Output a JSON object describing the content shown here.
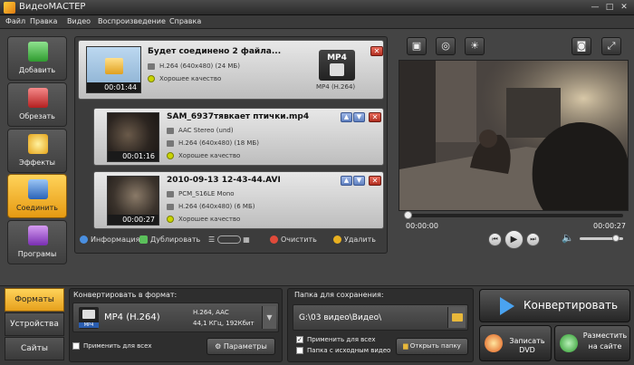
{
  "app": {
    "title": "ВидеоМАСТЕР"
  },
  "menu": [
    "Файл",
    "Правка",
    "Видео",
    "Воспроизведение",
    "Справка"
  ],
  "sidebar": {
    "items": [
      {
        "label": "Добавить",
        "icon": "add-icon"
      },
      {
        "label": "Обрезать",
        "icon": "trim-icon"
      },
      {
        "label": "Эффекты",
        "icon": "effects-icon"
      },
      {
        "label": "Соединить",
        "icon": "join-icon",
        "active": true
      },
      {
        "label": "Програмы",
        "icon": "programs-icon"
      }
    ]
  },
  "merged": {
    "title": "Будет соединено 2 файла...",
    "video": "H.264 (640x480) (24 МБ)",
    "quality": "Хорошее качество",
    "duration": "00:01:44",
    "format_badge": "MP4",
    "format_label": "MP4 (H.264)"
  },
  "clips": [
    {
      "name": "SAM_6937тявкает птички.mp4",
      "audio": "AAC Stereo (und)",
      "video": "H.264 (640x480) (18 МБ)",
      "quality": "Хорошее качество",
      "duration": "00:01:16",
      "checked": true
    },
    {
      "name": "2010-09-13 12-43-44.AVI",
      "audio": "PCM_S16LE Mono",
      "video": "H.264 (640x480) (6 МБ)",
      "quality": "Хорошее качество",
      "duration": "00:00:27",
      "checked": true
    }
  ],
  "list_toolbar": {
    "info": "Информация",
    "duplicate": "Дублировать",
    "clear": "Очистить",
    "delete": "Удалить"
  },
  "player": {
    "current_time": "00:00:00",
    "total_time": "00:00:27",
    "progress": 0.0,
    "volume": 0.9
  },
  "bottom_tabs": [
    "Форматы",
    "Устройства",
    "Сайты"
  ],
  "convert": {
    "label": "Конвертировать в формат:",
    "format": "MP4 (H.264)",
    "format_badge": "MP4",
    "codec_line1": "H.264, AAC",
    "codec_line2": "44,1 КГц, 192Кбит",
    "apply_all": "Применить для всех",
    "params": "Параметры"
  },
  "save": {
    "label": "Папка для сохранения:",
    "path": "G:\\03 видео\\Видео\\",
    "apply_all": "Применить для всех",
    "source_folder": "Папка с исходным видео",
    "open_folder": "Открыть папку"
  },
  "actions": {
    "convert": "Конвертировать",
    "burn_dvd": "Записать DVD",
    "publish_line1": "Разместить",
    "publish_line2": "на сайте"
  }
}
